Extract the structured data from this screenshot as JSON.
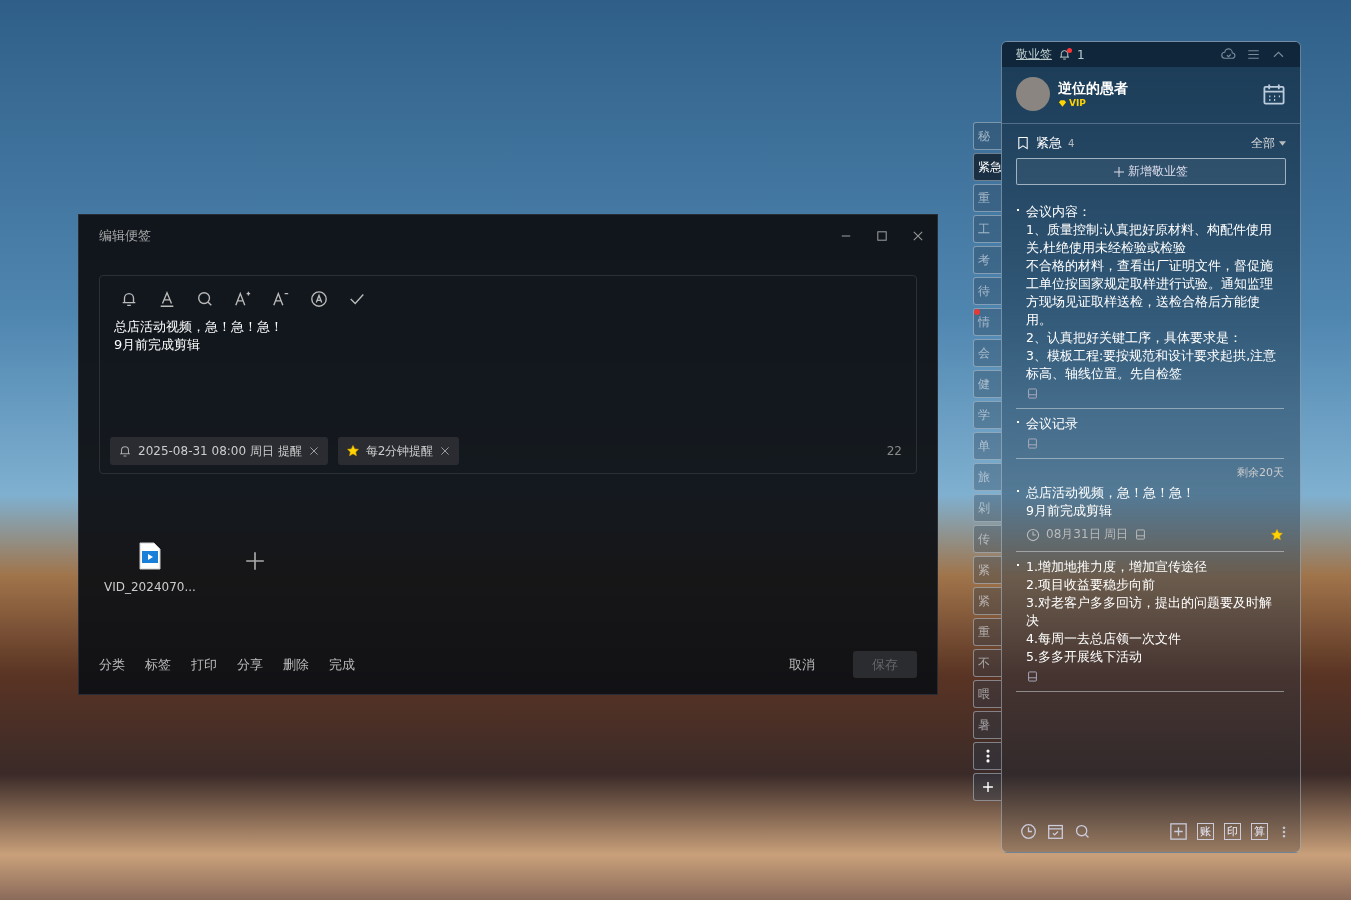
{
  "editor": {
    "title": "编辑便签",
    "content": [
      "总店活动视频，急！急！急！",
      "9月前完成剪辑"
    ],
    "reminders": [
      {
        "kind": "alarm",
        "label": "2025-08-31 08:00 周日 提醒"
      },
      {
        "kind": "star",
        "label": "每2分钟提醒"
      }
    ],
    "char_count": "22",
    "attachments": [
      {
        "name": "VID_2024070..."
      }
    ],
    "actions": [
      "分类",
      "标签",
      "打印",
      "分享",
      "删除",
      "完成"
    ],
    "cancel": "取消",
    "save": {
      "label": "保存",
      "disabled": true
    }
  },
  "panel": {
    "app_name": "敬业签",
    "notification_count": "1",
    "user": {
      "name": "逆位的愚者",
      "badge": "VIP"
    },
    "category": {
      "name": "紧急",
      "count": "4",
      "filter": "全部"
    },
    "add_button": "新增敬业签",
    "tabs": [
      {
        "label": "秘",
        "selected": false,
        "alert": false
      },
      {
        "label": "紧急",
        "selected": true,
        "alert": false
      },
      {
        "label": "重",
        "selected": false,
        "alert": false
      },
      {
        "label": "工",
        "selected": false,
        "alert": false
      },
      {
        "label": "考",
        "selected": false,
        "alert": false
      },
      {
        "label": "待",
        "selected": false,
        "alert": false
      },
      {
        "label": "情",
        "selected": false,
        "alert": true
      },
      {
        "label": "会",
        "selected": false,
        "alert": false
      },
      {
        "label": "健",
        "selected": false,
        "alert": false
      },
      {
        "label": "学",
        "selected": false,
        "alert": false
      },
      {
        "label": "单",
        "selected": false,
        "alert": false
      },
      {
        "label": "旅",
        "selected": false,
        "alert": false
      },
      {
        "label": "剁",
        "selected": false,
        "alert": false
      },
      {
        "label": "传",
        "selected": false,
        "alert": false
      },
      {
        "label": "紧",
        "selected": false,
        "alert": false
      },
      {
        "label": "紧",
        "selected": false,
        "alert": false
      },
      {
        "label": "重",
        "selected": false,
        "alert": false
      },
      {
        "label": "不",
        "selected": false,
        "alert": false
      },
      {
        "label": "喂",
        "selected": false,
        "alert": false
      },
      {
        "label": "暑",
        "selected": false,
        "alert": false
      }
    ],
    "notes": [
      {
        "lines": [
          "会议内容：",
          "1、质量控制:认真把好原材料、构配件使用关,杜绝使用未经检验或检验",
          "不合格的材料，查看出厂证明文件，督促施工单位按国家规定取样进行试验。通知监理方现场见证取样送检，送检合格后方能使用。",
          "2、认真把好关键工序，具体要求是：",
          "3、模板工程:要按规范和设计要求起拱,注意标高、轴线位置。先自检签"
        ],
        "starred": false
      },
      {
        "lines": [
          "会议记录"
        ],
        "starred": false
      },
      {
        "remaining": "剩余20天",
        "lines": [
          "总店活动视频，急！急！急！",
          "9月前完成剪辑"
        ],
        "date": "08月31日 周日",
        "starred": true
      },
      {
        "lines": [
          "1.增加地推力度，增加宣传途径",
          "2.项目收益要稳步向前",
          "3.对老客户多多回访，提出的问题要及时解决",
          "4.每周一去总店领一次文件",
          "5.多多开展线下活动"
        ],
        "starred": false
      }
    ],
    "footer_tools": [
      "账",
      "印",
      "算"
    ]
  }
}
